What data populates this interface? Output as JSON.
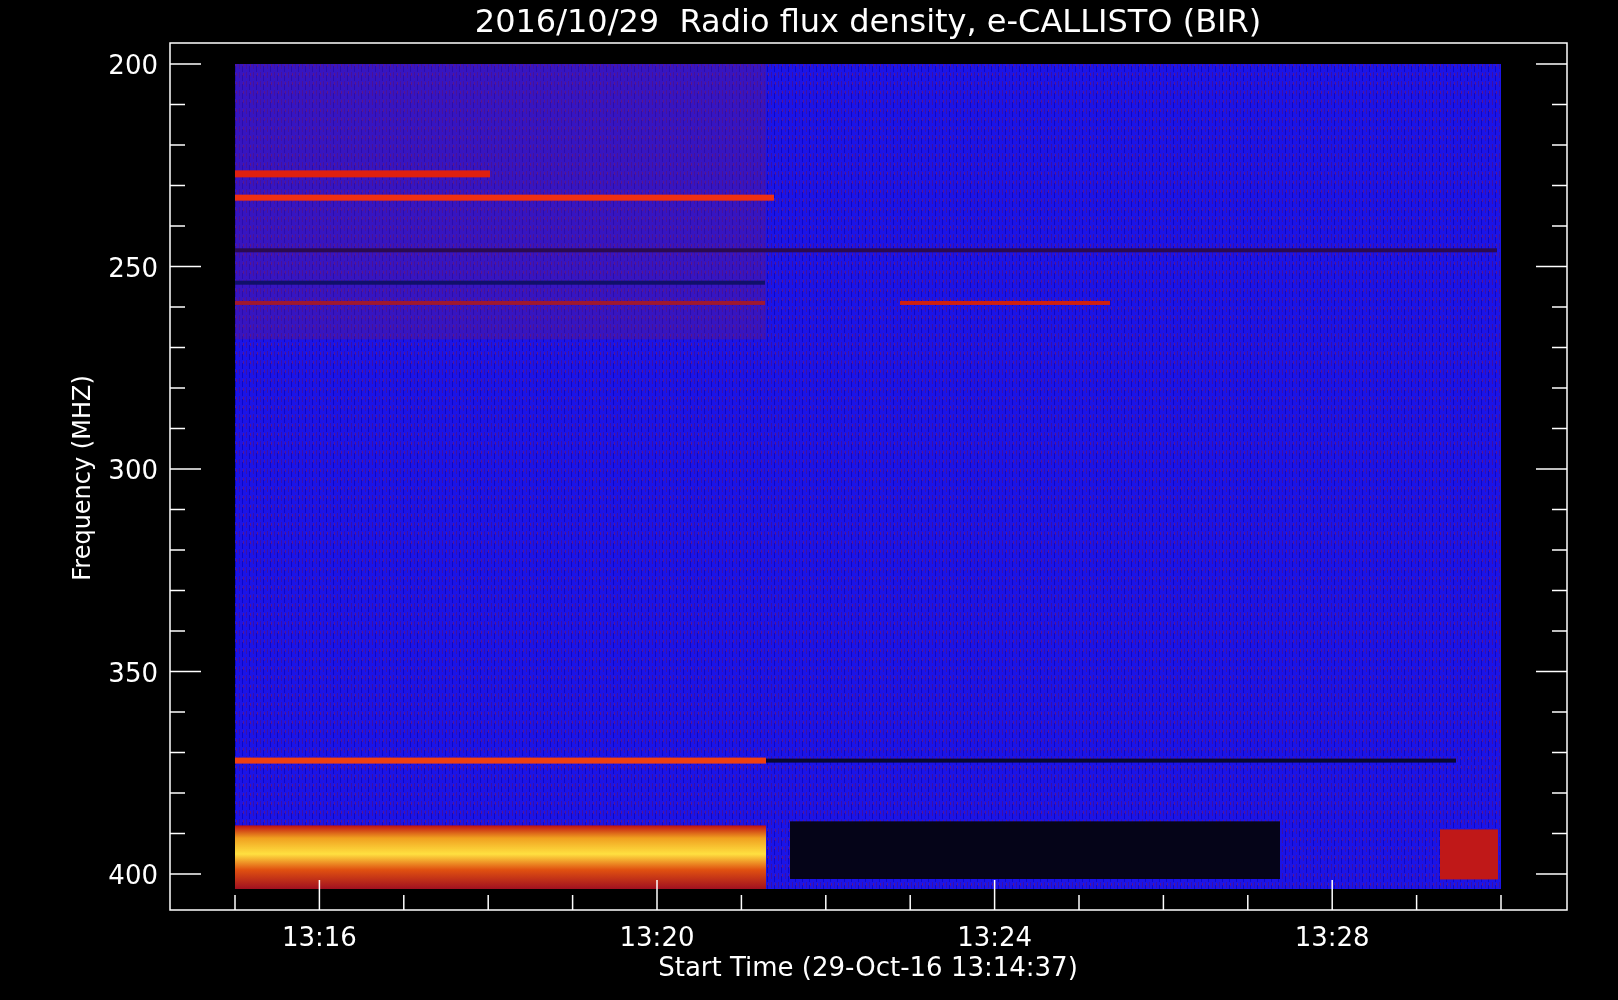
{
  "title": "2016/10/29  Radio flux density, e-CALLISTO (BIR)",
  "y_axis": {
    "label": "Frequency (MHZ)",
    "ticks": [
      "200",
      "250",
      "300",
      "350",
      "400"
    ]
  },
  "x_axis": {
    "label": "Start Time (29-Oct-16 13:14:37)",
    "ticks": [
      "13:16",
      "13:20",
      "13:24",
      "13:28"
    ]
  }
}
